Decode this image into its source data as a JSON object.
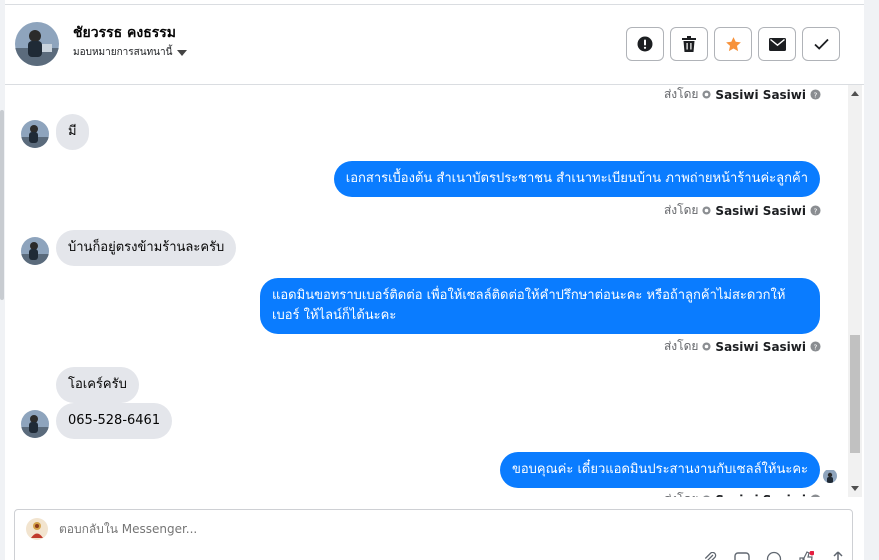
{
  "conversation": {
    "contact_name": "ชัยวรรธ คงธรรม",
    "assign_label": "มอบหมายการสนทนานี้",
    "actions": [
      {
        "name": "report-button",
        "icon": "exclamation-circle-icon"
      },
      {
        "name": "delete-button",
        "icon": "trash-icon"
      },
      {
        "name": "star-button",
        "icon": "star-icon"
      },
      {
        "name": "mark-unread-button",
        "icon": "envelope-icon"
      },
      {
        "name": "mark-done-button",
        "icon": "checkmark-icon"
      }
    ]
  },
  "sent_by": {
    "prefix": "ส่งโดย",
    "name": "Sasiwi Sasiwi"
  },
  "messages": [
    {
      "dir": "in",
      "text": "มี"
    },
    {
      "dir": "out",
      "text": "เอกสารเบื้องต้น สำเนาบัตรประชาชน สำเนาทะเบียนบ้าน ภาพถ่ายหน้าร้านค่ะลูกค้า"
    },
    {
      "dir": "in",
      "text": "บ้านก็อยู่ตรงข้ามร้านละครับ"
    },
    {
      "dir": "out",
      "text": "แอดมินขอทราบเบอร์ติดต่อ เพื่อให้เซลล์ติดต่อให้คำปรึกษาต่อนะคะ หรือถ้าลูกค้าไม่สะดวกให้เบอร์ ให้ไลน์ก็ได้นะคะ"
    },
    {
      "dir": "in",
      "text": "โอเคร์ครับ"
    },
    {
      "dir": "in",
      "text": "065-528-6461"
    },
    {
      "dir": "out",
      "text": "ขอบคุณค่ะ เดี๋ยวแอดมินประสานงานกับเซลล์ให้นะคะ"
    }
  ],
  "composer": {
    "placeholder": "ตอบกลับใน Messenger..."
  },
  "colors": {
    "outgoing_bubble": "#0a7cff",
    "incoming_bubble": "#e4e6eb",
    "star": "#f7923b"
  }
}
